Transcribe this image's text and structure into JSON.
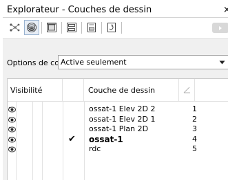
{
  "window": {
    "title": "Explorateur - Couches de dessin",
    "close_glyph": "×"
  },
  "toolbar": {
    "buttons": [
      {
        "icon": "network-tree-icon"
      },
      {
        "icon": "layers-icon"
      },
      {
        "icon": "view-window-icon"
      },
      {
        "icon": "frame-icon"
      },
      {
        "icon": "sheet-icon"
      },
      {
        "icon": "refresh-icon"
      }
    ]
  },
  "options": {
    "label": "Options de couc",
    "selected": "Active seulement"
  },
  "grid": {
    "headers": {
      "visibility": "Visibilité",
      "layer": "Couche de dessin"
    },
    "rows": [
      {
        "visible": true,
        "active": false,
        "name": "ossat-1 Elev 2D  2",
        "num": "1"
      },
      {
        "visible": true,
        "active": false,
        "name": "ossat-1 Elev 2D  1",
        "num": "2"
      },
      {
        "visible": true,
        "active": false,
        "name": "ossat-1 Plan 2D",
        "num": "3"
      },
      {
        "visible": true,
        "active": true,
        "name": "ossat-1",
        "num": "4",
        "check": "✔"
      },
      {
        "visible": true,
        "active": false,
        "name": "rdc",
        "num": "5"
      }
    ]
  },
  "colors": {
    "panel_bg": "#f0f0f0",
    "grid_bg": "#ffffff",
    "accent_border": "#9ab3d0"
  }
}
